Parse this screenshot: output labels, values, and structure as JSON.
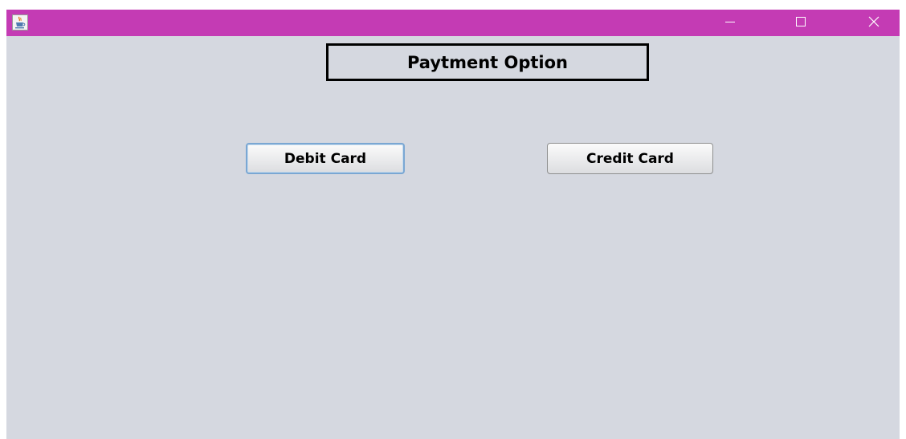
{
  "window": {
    "titlebar_color": "#c43bb4",
    "background_color": "#d5d8e0",
    "app_icon": "java-coffee-cup-icon",
    "controls": {
      "minimize_icon": "minimize-icon",
      "maximize_icon": "maximize-icon",
      "close_icon": "close-icon"
    }
  },
  "main": {
    "heading": "Paytment Option",
    "buttons": {
      "debit_label": "Debit Card",
      "credit_label": "Credit Card"
    }
  }
}
